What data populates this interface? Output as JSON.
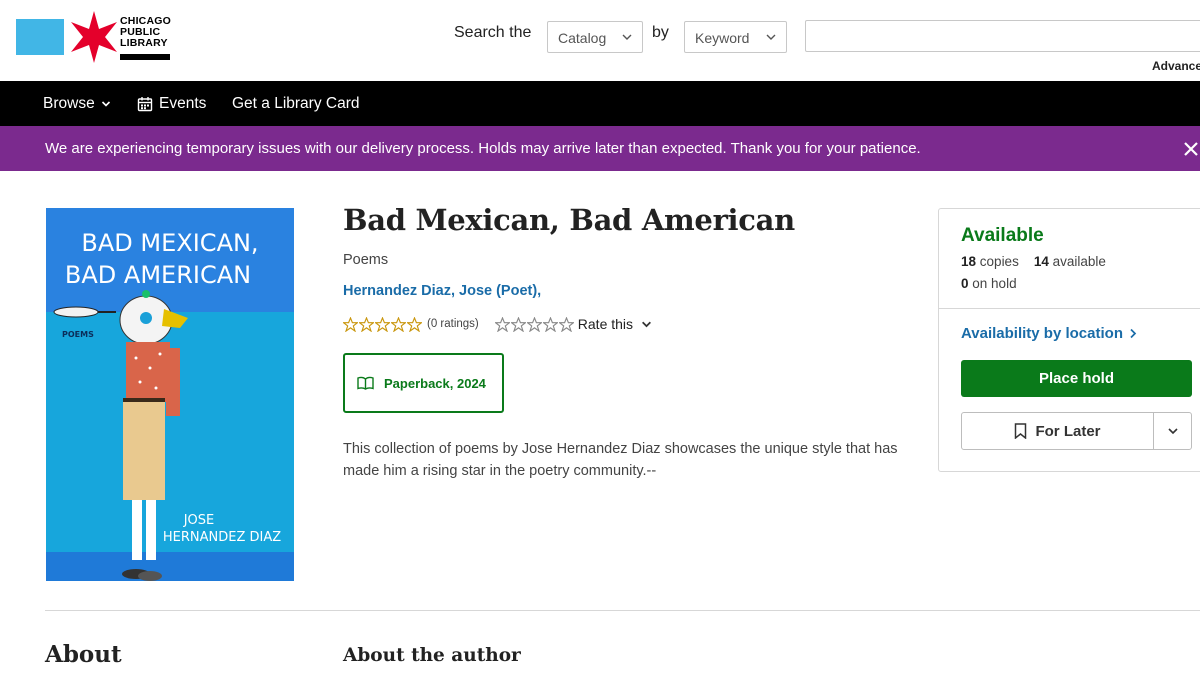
{
  "header": {
    "logo_lines": [
      "CHICAGO",
      "PUBLIC",
      "LIBRARY"
    ],
    "search_label": "Search the",
    "scope_select": "Catalog",
    "by_label": "by",
    "type_select": "Keyword",
    "search_value": "",
    "advanced_link": "Advanced"
  },
  "nav": {
    "browse": "Browse",
    "events": "Events",
    "library_card": "Get a Library Card"
  },
  "alert": {
    "message": "We are experiencing temporary issues with our delivery process. Holds may arrive later than expected. Thank you for your patience."
  },
  "cover": {
    "title_line1": "BAD MEXICAN,",
    "title_line2": "BAD AMERICAN",
    "genre": "POEMS",
    "author_line1": "JOSE",
    "author_line2": "HERNANDEZ DIAZ"
  },
  "book": {
    "title": "Bad Mexican, Bad American",
    "subtitle": "Poems",
    "author": "Hernandez Diaz, Jose (Poet),",
    "rating_count": "(0 ratings)",
    "rate_label": "Rate this",
    "format": "Paperback, 2024",
    "description": "This collection of poems by Jose Hernandez Diaz showcases the unique style that has made him a rising star in the poetry community.--"
  },
  "availability": {
    "status": "Available",
    "copies": "18",
    "copies_label": "copies",
    "available": "14",
    "available_label": "available",
    "on_hold": "0",
    "on_hold_label": "on hold",
    "location_link": "Availability by location",
    "place_hold": "Place hold",
    "for_later": "For Later"
  },
  "sections": {
    "about": "About",
    "about_author": "About the author"
  },
  "colors": {
    "nav_bg": "#000000",
    "alert_bg": "#7b2a8e",
    "accent_green": "#0a7a1a",
    "link_blue": "#1a6ca8",
    "logo_blue": "#41b6e6",
    "logo_red": "#e4002b",
    "star_gold": "#c9960c"
  }
}
